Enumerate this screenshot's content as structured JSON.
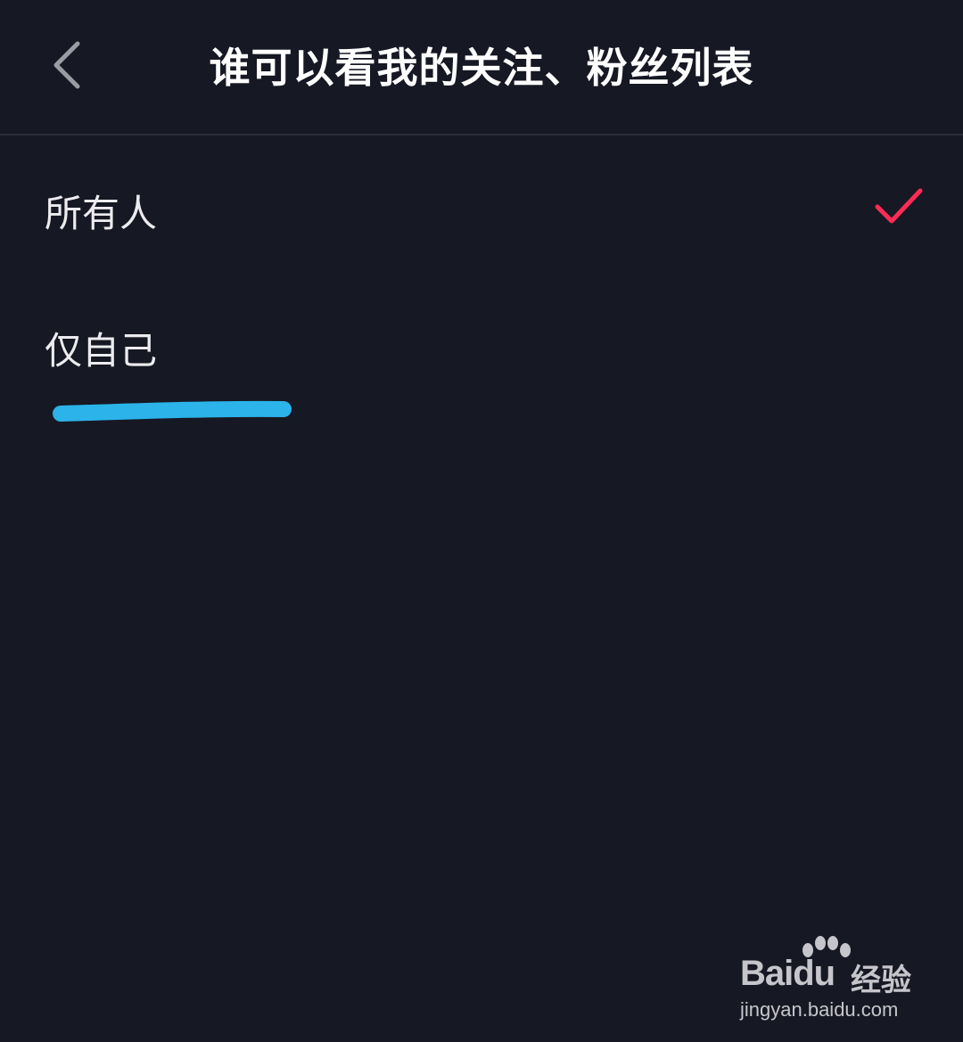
{
  "header": {
    "title": "谁可以看我的关注、粉丝列表",
    "back_icon": "chevron-left-icon"
  },
  "options": [
    {
      "label": "所有人",
      "selected": true
    },
    {
      "label": "仅自己",
      "selected": false
    }
  ],
  "colors": {
    "background": "#161823",
    "check": "#fe2c55",
    "annotation": "#2bb3ea"
  },
  "watermark": {
    "brand": "Bai",
    "brand_du": "du",
    "product": "经验",
    "url": "jingyan.baidu.com"
  }
}
